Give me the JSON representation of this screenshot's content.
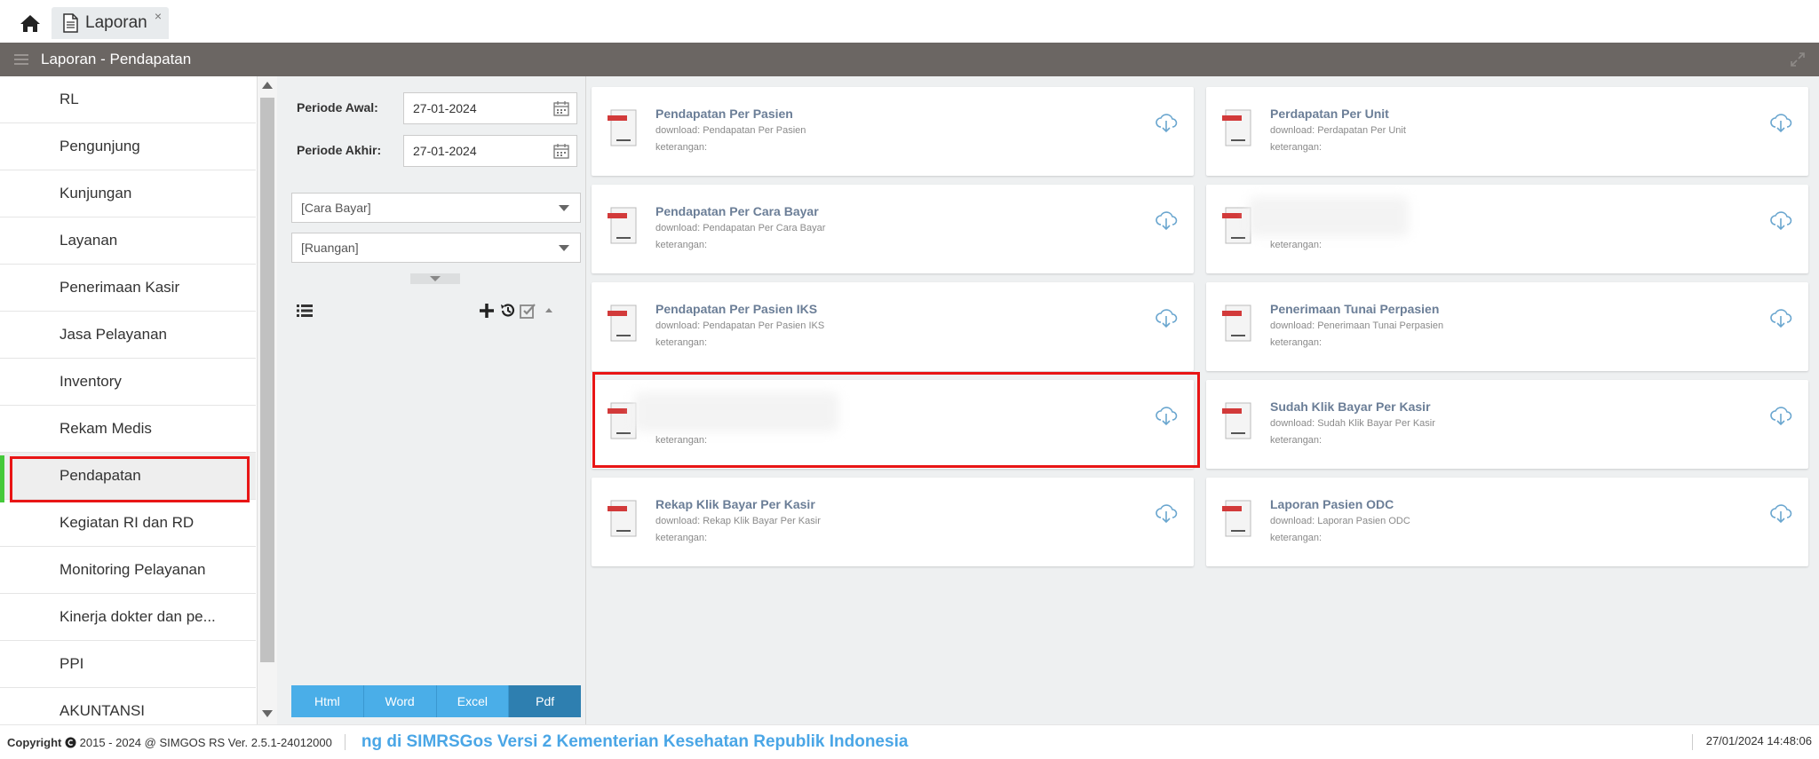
{
  "tabs": [
    {
      "label": "Laporan",
      "close": "×"
    }
  ],
  "header": {
    "title": "Laporan - Pendapatan"
  },
  "nav": {
    "items": [
      {
        "label": "RL"
      },
      {
        "label": "Pengunjung"
      },
      {
        "label": "Kunjungan"
      },
      {
        "label": "Layanan"
      },
      {
        "label": "Penerimaan Kasir"
      },
      {
        "label": "Jasa Pelayanan"
      },
      {
        "label": "Inventory"
      },
      {
        "label": "Rekam Medis"
      },
      {
        "label": "Pendapatan"
      },
      {
        "label": "Kegiatan RI dan RD"
      },
      {
        "label": "Monitoring Pelayanan"
      },
      {
        "label": "Kinerja dokter dan pe..."
      },
      {
        "label": "PPI"
      },
      {
        "label": "AKUNTANSI"
      }
    ],
    "active": "Pendapatan"
  },
  "filter": {
    "periode_awal_label": "Periode Awal:",
    "periode_awal_value": "27-01-2024",
    "periode_akhir_label": "Periode Akhir:",
    "periode_akhir_value": "27-01-2024",
    "cara_bayar": "[Cara Bayar]",
    "ruangan": "[Ruangan]",
    "formats": [
      "Html",
      "Word",
      "Excel",
      "Pdf"
    ],
    "active_format": "Pdf"
  },
  "reports": [
    {
      "title": "Pendapatan Per Pasien",
      "download": "download: Pendapatan Per Pasien",
      "keterangan": "keterangan:"
    },
    {
      "title": "Perdapatan Per Unit",
      "download": "download: Perdapatan Per Unit",
      "keterangan": "keterangan:"
    },
    {
      "title": "Pendapatan Per Cara Bayar",
      "download": "download: Pendapatan Per Cara Bayar",
      "keterangan": "keterangan:"
    },
    {
      "title": "",
      "download": "",
      "keterangan": "keterangan:",
      "blurred": true
    },
    {
      "title": "Pendapatan Per Pasien IKS",
      "download": "download: Pendapatan Per Pasien IKS",
      "keterangan": "keterangan:"
    },
    {
      "title": "Penerimaan Tunai Perpasien",
      "download": "download: Penerimaan Tunai Perpasien",
      "keterangan": "keterangan:"
    },
    {
      "title": "",
      "download": "",
      "keterangan": "keterangan:",
      "blurred": true
    },
    {
      "title": "Sudah Klik Bayar Per Kasir",
      "download": "download: Sudah Klik Bayar Per Kasir",
      "keterangan": "keterangan:"
    },
    {
      "title": "Rekap Klik Bayar Per Kasir",
      "download": "download: Rekap Klik Bayar Per Kasir",
      "keterangan": "keterangan:"
    },
    {
      "title": "Laporan Pasien ODC",
      "download": "download: Laporan Pasien ODC",
      "keterangan": "keterangan:"
    }
  ],
  "footer": {
    "copyright": "Copyright",
    "copyright_rest": "2015 - 2024 @ SIMGOS RS Ver. 2.5.1-24012000",
    "marquee": "ng di SIMRSGos Versi 2 Kementerian Kesehatan Republik Indonesia",
    "datetime": "27/01/2024 14:48:06"
  },
  "colors": {
    "accent": "#4aaee8",
    "highlight": "#e81515",
    "active_bar": "#45c93a",
    "header": "#6b6663"
  },
  "icons": [
    "home-icon",
    "document-icon",
    "menu-icon",
    "expand-icon",
    "calendar-icon",
    "list-icon",
    "plus-icon",
    "history-icon",
    "check-icon",
    "chevron-up-icon",
    "pdf-document-icon",
    "cloud-download-icon",
    "copyright-icon"
  ]
}
